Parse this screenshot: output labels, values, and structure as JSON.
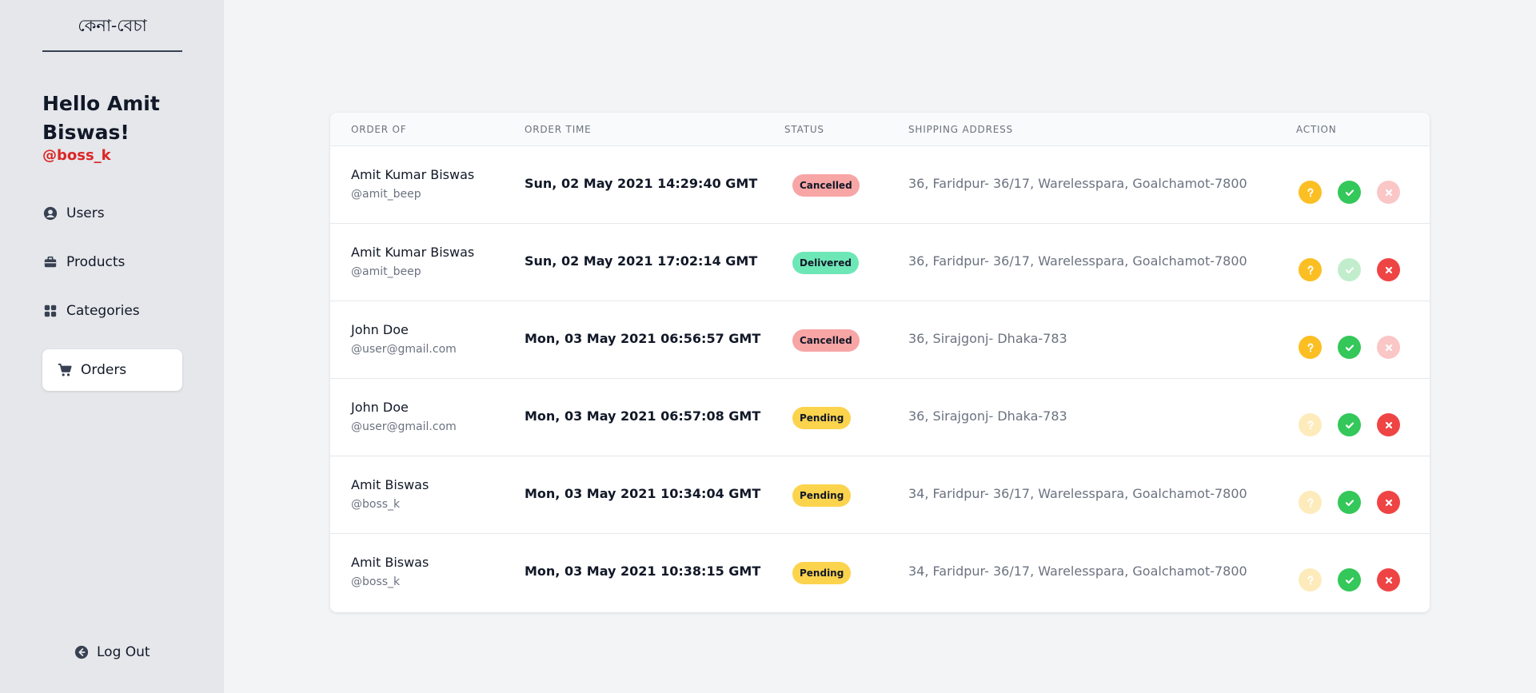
{
  "sidebar": {
    "brand": "কেনা-বেচা",
    "greeting": "Hello Amit Biswas!",
    "username": "@boss_k",
    "nav": [
      {
        "label": "Users",
        "icon": "user-circle-icon"
      },
      {
        "label": "Products",
        "icon": "briefcase-icon"
      },
      {
        "label": "Categories",
        "icon": "grid-icon"
      },
      {
        "label": "Orders",
        "icon": "cart-icon",
        "active": true
      }
    ],
    "logout": "Log Out"
  },
  "table": {
    "headers": [
      "ORDER OF",
      "ORDER TIME",
      "STATUS",
      "SHIPPING ADDRESS",
      "ACTION"
    ],
    "status_colors": {
      "Cancelled": "#f8a5a5",
      "Delivered": "#6ee7b7",
      "Pending": "#fcd34d"
    },
    "action_colors": {
      "pending": "#fbbf24",
      "deliver": "#34c759",
      "cancel": "#ef4444"
    },
    "rows": [
      {
        "name": "Amit Kumar Biswas",
        "handle": "@amit_beep",
        "time": "Sun, 02 May 2021 14:29:40 GMT",
        "status": "Cancelled",
        "address": "36, Faridpur- 36/17, Warelesspara, Goalchamot-7800",
        "enabled": {
          "pending": true,
          "deliver": true,
          "cancel": false
        }
      },
      {
        "name": "Amit Kumar Biswas",
        "handle": "@amit_beep",
        "time": "Sun, 02 May 2021 17:02:14 GMT",
        "status": "Delivered",
        "address": "36, Faridpur- 36/17, Warelesspara, Goalchamot-7800",
        "enabled": {
          "pending": true,
          "deliver": false,
          "cancel": true
        }
      },
      {
        "name": "John Doe",
        "handle": "@user@gmail.com",
        "time": "Mon, 03 May 2021 06:56:57 GMT",
        "status": "Cancelled",
        "address": "36, Sirajgonj- Dhaka-783",
        "enabled": {
          "pending": true,
          "deliver": true,
          "cancel": false
        }
      },
      {
        "name": "John Doe",
        "handle": "@user@gmail.com",
        "time": "Mon, 03 May 2021 06:57:08 GMT",
        "status": "Pending",
        "address": "36, Sirajgonj- Dhaka-783",
        "enabled": {
          "pending": false,
          "deliver": true,
          "cancel": true
        }
      },
      {
        "name": "Amit Biswas",
        "handle": "@boss_k",
        "time": "Mon, 03 May 2021 10:34:04 GMT",
        "status": "Pending",
        "address": "34, Faridpur- 36/17, Warelesspara, Goalchamot-7800",
        "enabled": {
          "pending": false,
          "deliver": true,
          "cancel": true
        }
      },
      {
        "name": "Amit Biswas",
        "handle": "@boss_k",
        "time": "Mon, 03 May 2021 10:38:15 GMT",
        "status": "Pending",
        "address": "34, Faridpur- 36/17, Warelesspara, Goalchamot-7800",
        "enabled": {
          "pending": false,
          "deliver": true,
          "cancel": true
        }
      }
    ]
  }
}
